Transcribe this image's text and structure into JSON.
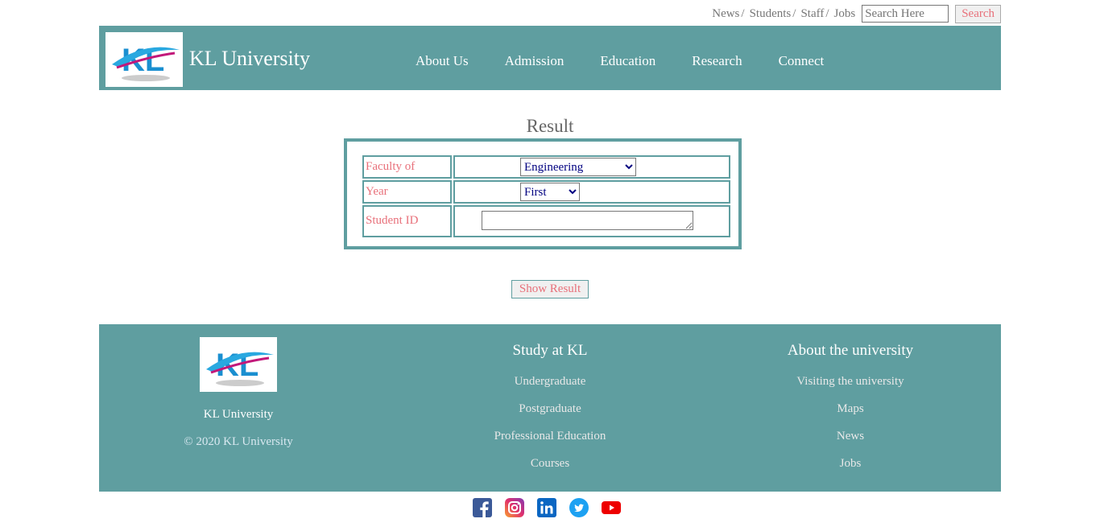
{
  "topbar": {
    "links": [
      "News",
      "Students",
      "Staff",
      "Jobs"
    ],
    "search_placeholder": "Search Here",
    "search_button": "Search"
  },
  "header": {
    "logo_text": "KL",
    "title": "KL University",
    "nav": [
      "About Us",
      "Admission",
      "Education",
      "Research",
      "Connect"
    ]
  },
  "form": {
    "title": "Result",
    "faculty_label": "Faculty of",
    "faculty_value": "Engineering",
    "year_label": "Year",
    "year_value": "First",
    "student_id_label": "Student ID",
    "student_id_value": "",
    "submit_label": "Show Result"
  },
  "footer": {
    "logo_text": "KL",
    "brand": "KL University",
    "copyright": "© 2020 KL University",
    "study": {
      "heading": "Study at KL",
      "links": [
        "Undergraduate",
        "Postgraduate",
        "Professional Education",
        "Courses"
      ]
    },
    "about": {
      "heading": "About the university",
      "links": [
        "Visiting the university",
        "Maps",
        "News",
        "Jobs"
      ]
    }
  },
  "social": [
    "facebook-icon",
    "instagram-icon",
    "linkedin-icon",
    "twitter-icon",
    "youtube-icon"
  ],
  "colors": {
    "teal": "#5f9ea0",
    "label_pink": "#e8707a",
    "white": "#ffffff"
  }
}
